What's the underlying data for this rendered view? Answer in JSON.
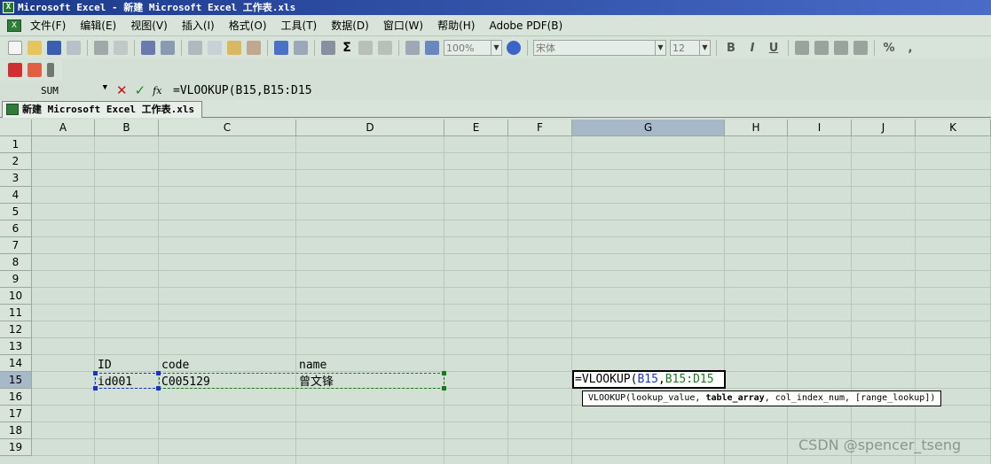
{
  "window": {
    "title": "Microsoft Excel - 新建 Microsoft Excel 工作表.xls",
    "app_icon": "X"
  },
  "menu": {
    "items": [
      "文件(F)",
      "编辑(E)",
      "视图(V)",
      "插入(I)",
      "格式(O)",
      "工具(T)",
      "数据(D)",
      "窗口(W)",
      "帮助(H)",
      "Adobe PDF(B)"
    ]
  },
  "toolbar": {
    "zoom": "100%",
    "font": "宋体",
    "font_size": "12",
    "sigma": "Σ",
    "bold": "B",
    "italic": "I",
    "underline": "U",
    "percent": "%",
    "comma": ","
  },
  "formula_bar": {
    "name_box": "SUM",
    "cancel": "✕",
    "enter": "✓",
    "fx": "fx",
    "formula": "=VLOOKUP(B15,B15:D15"
  },
  "workbook_tab": {
    "label": "新建 Microsoft Excel 工作表.xls"
  },
  "columns": [
    "A",
    "B",
    "C",
    "D",
    "E",
    "F",
    "G",
    "H",
    "I",
    "J",
    "K"
  ],
  "rows": [
    "1",
    "2",
    "3",
    "4",
    "5",
    "6",
    "7",
    "8",
    "9",
    "10",
    "11",
    "12",
    "13",
    "14",
    "15",
    "16",
    "17",
    "18",
    "19"
  ],
  "active_column": "G",
  "active_row": "15",
  "cells": {
    "B14": "ID",
    "C14": "code",
    "D14": "name",
    "B15": "id001",
    "C15": "C005129",
    "D15": "曾文锋"
  },
  "active_cell": {
    "prefix": "=VLOOKUP(",
    "ref1": "B15",
    "sep": ",",
    "ref2": "B15:D15"
  },
  "tooltip": {
    "func": "VLOOKUP(",
    "arg1": "lookup_value, ",
    "arg2_bold": "table_array",
    "rest": ", col_index_num, [range_lookup])"
  },
  "colors": {
    "ref1": "#1a34c8",
    "ref2": "#1a7a1a",
    "title_bar": "#1c3b8c",
    "grid_bg": "#d2e0d6"
  },
  "watermark": "CSDN @spencer_tseng"
}
